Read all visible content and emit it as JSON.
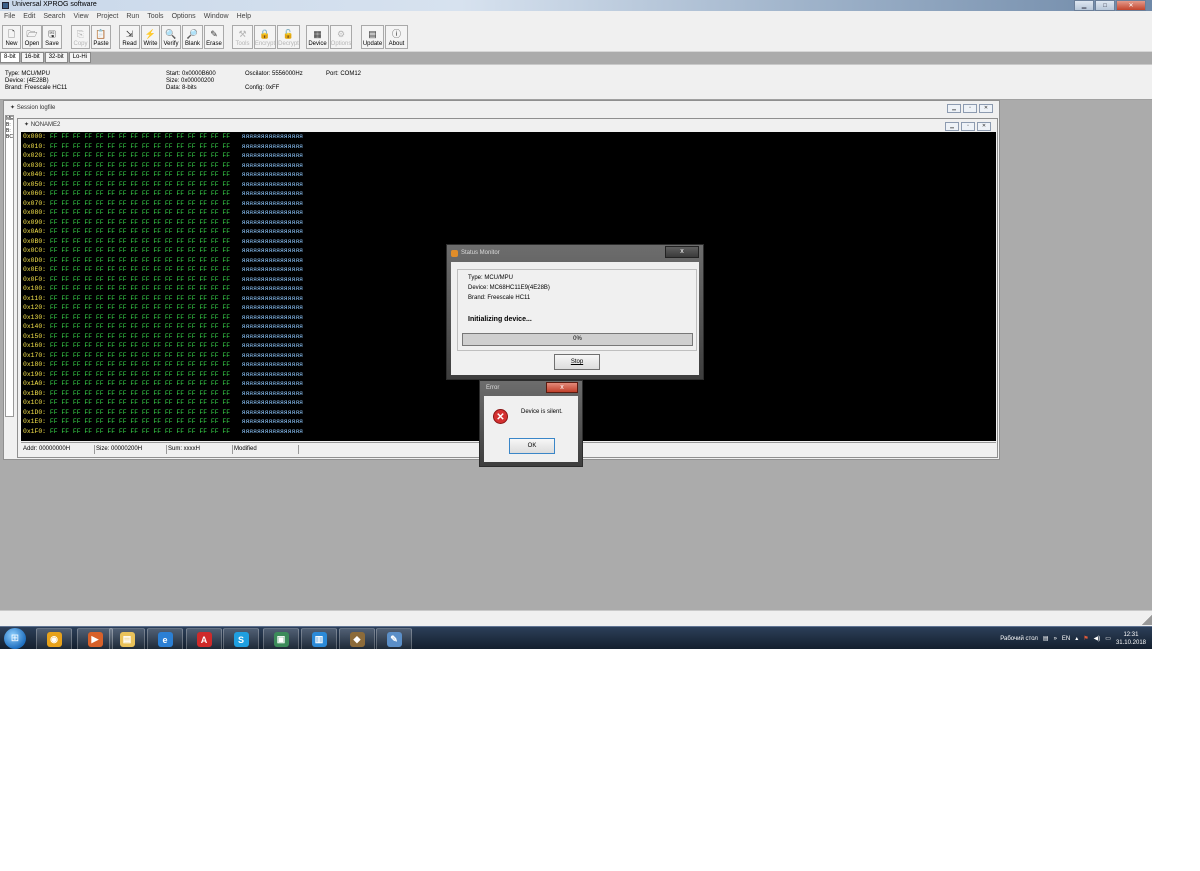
{
  "window": {
    "title": "Universal XPROG software"
  },
  "menu": [
    "File",
    "Edit",
    "Search",
    "View",
    "Project",
    "Run",
    "Tools",
    "Options",
    "Window",
    "Help"
  ],
  "toolbar": [
    {
      "label": "New",
      "icon": "new-icon",
      "disabled": false
    },
    {
      "label": "Open",
      "icon": "open-icon",
      "disabled": false
    },
    {
      "label": "Save",
      "icon": "save-icon",
      "disabled": false
    },
    {
      "label": "Copy",
      "icon": "copy-icon",
      "disabled": true
    },
    {
      "label": "Paste",
      "icon": "paste-icon",
      "disabled": false
    },
    {
      "label": "Read",
      "icon": "read-icon",
      "disabled": false
    },
    {
      "label": "Write",
      "icon": "write-icon",
      "disabled": false
    },
    {
      "label": "Verify",
      "icon": "verify-icon",
      "disabled": false
    },
    {
      "label": "Blank",
      "icon": "blank-icon",
      "disabled": false
    },
    {
      "label": "Erase",
      "icon": "erase-icon",
      "disabled": false
    },
    {
      "label": "Tools",
      "icon": "tools-icon",
      "disabled": true
    },
    {
      "label": "Encrypt",
      "icon": "encrypt-icon",
      "disabled": true
    },
    {
      "label": "Decrypt",
      "icon": "decrypt-icon",
      "disabled": true
    },
    {
      "label": "Device",
      "icon": "device-icon",
      "disabled": false
    },
    {
      "label": "Options",
      "icon": "options-icon",
      "disabled": true
    },
    {
      "label": "Update",
      "icon": "update-icon",
      "disabled": false
    },
    {
      "label": "About",
      "icon": "about-icon",
      "disabled": false
    }
  ],
  "bit_tabs": [
    "8-bit",
    "16-bit",
    "32-bit",
    "Lo-Hi"
  ],
  "device_info": {
    "type": "Type: MCU/MPU",
    "device": "Device: (4E28B)",
    "brand": "Brand: Freescale HC11",
    "start": "Start: 0x0000B600",
    "size": "Size: 0x00000200",
    "data": "Data: 8-bits",
    "oscilator": "Oscilator: 5556000Hz",
    "config": "Config: 0xFF",
    "port": "Port: COM12"
  },
  "session_window": {
    "title": "Session logfile",
    "log_lines": [
      "ME",
      "B:",
      "B:",
      "BC"
    ]
  },
  "noname_window": {
    "title": "NONAME2"
  },
  "hex": {
    "row_count": 32,
    "byte_text": "FF FF FF FF FF FF FF FF FF FF FF FF FF FF FF FF",
    "ascii_text": "яяяяяяяяяяяяяяяя"
  },
  "hex_status": {
    "addr": "Addr: 00000000H",
    "size": "Size: 00000200H",
    "sum": "Sum: xxxxH",
    "state": "Modified"
  },
  "status_monitor": {
    "title": "Status Monitor",
    "close": "x",
    "type": "Type: MCU/MPU",
    "device": "Device: MC68HC11E9(4E28B)",
    "brand": "Brand: Freescale HC11",
    "status": "Initializing device...",
    "progress": 0,
    "progress_label": "0%",
    "stop_label": "Stop"
  },
  "error_dialog": {
    "title": "Error",
    "close": "x",
    "message": "Device is silent.",
    "ok_label": "OK"
  },
  "taskbar": {
    "apps": [
      {
        "name": "chrome",
        "color": "#e7a21b",
        "glyph": "◉"
      },
      {
        "name": "media-player",
        "color": "#d8612a",
        "glyph": "▶"
      },
      {
        "name": "explorer",
        "color": "#e9c25a",
        "glyph": "▤"
      },
      {
        "name": "internet-explorer",
        "color": "#2b7fd4",
        "glyph": "e"
      },
      {
        "name": "acrobat",
        "color": "#cf2a2a",
        "glyph": "A"
      },
      {
        "name": "skype",
        "color": "#1f9fe0",
        "glyph": "S"
      },
      {
        "name": "chip-programmer",
        "color": "#3c8b5a",
        "glyph": "▣"
      },
      {
        "name": "document-app",
        "color": "#2b8ad8",
        "glyph": "▥"
      },
      {
        "name": "xprog",
        "color": "#8c6b3a",
        "glyph": "◆"
      },
      {
        "name": "paint",
        "color": "#5b8fc8",
        "glyph": "✎"
      }
    ],
    "desktop_label": "Рабочий стол",
    "language": "EN",
    "time": "12:31",
    "date": "31.10.2018"
  }
}
